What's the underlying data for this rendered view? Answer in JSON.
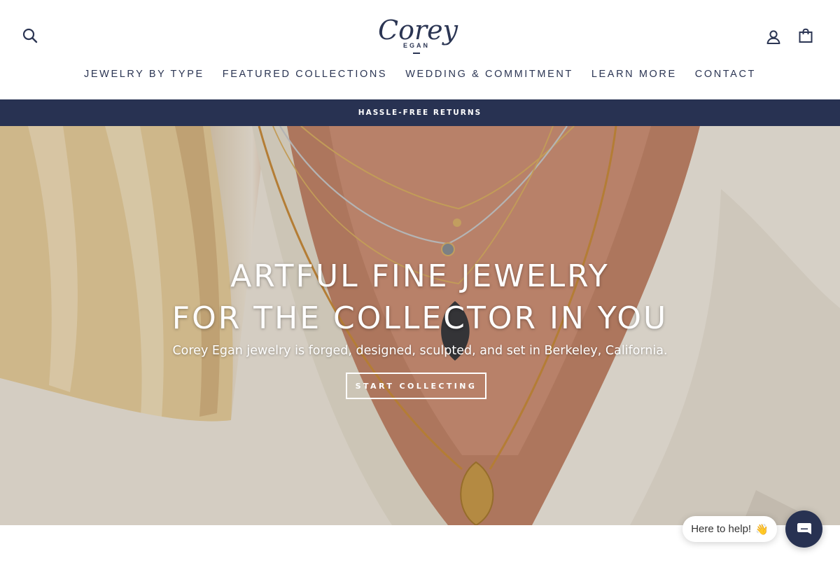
{
  "header": {
    "logo_text": "Corey",
    "logo_subtext": "EGAN",
    "icons": [
      "search-icon",
      "account-icon",
      "cart-icon"
    ]
  },
  "nav": {
    "items": [
      {
        "label": "JEWELRY BY TYPE"
      },
      {
        "label": "FEATURED COLLECTIONS"
      },
      {
        "label": "WEDDING & COMMITMENT"
      },
      {
        "label": "LEARN MORE"
      },
      {
        "label": "CONTACT"
      }
    ]
  },
  "announcement": {
    "text": "HASSLE-FREE RETURNS"
  },
  "hero": {
    "title_line1": "ARTFUL FINE JEWELRY",
    "title_line2": "FOR THE COLLECTOR IN YOU",
    "subtitle": "Corey Egan jewelry is forged, designed, sculpted, and set in Berkeley, California.",
    "cta_label": "START COLLECTING"
  },
  "chat": {
    "bubble_text": "Here to help!",
    "bubble_emoji": "👋"
  },
  "colors": {
    "brand_navy": "#283252",
    "text_navy": "#2b3553",
    "white": "#ffffff"
  }
}
